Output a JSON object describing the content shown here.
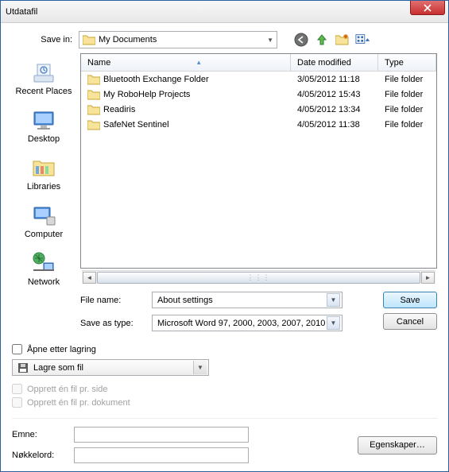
{
  "title": "Utdatafil",
  "savein": {
    "label": "Save in:",
    "value": "My Documents"
  },
  "columns": {
    "name": "Name",
    "date": "Date modified",
    "type": "Type"
  },
  "files": [
    {
      "name": "Bluetooth Exchange Folder",
      "date": "3/05/2012 11:18",
      "type": "File folder"
    },
    {
      "name": "My RoboHelp Projects",
      "date": "4/05/2012 15:43",
      "type": "File folder"
    },
    {
      "name": "Readiris",
      "date": "4/05/2012 13:34",
      "type": "File folder"
    },
    {
      "name": "SafeNet Sentinel",
      "date": "4/05/2012 11:38",
      "type": "File folder"
    }
  ],
  "places": {
    "recent": "Recent Places",
    "desktop": "Desktop",
    "libraries": "Libraries",
    "computer": "Computer",
    "network": "Network"
  },
  "form": {
    "filename_label": "File name:",
    "filename_value": "About settings",
    "savetype_label": "Save as type:",
    "savetype_value": "Microsoft Word 97, 2000, 2003, 2007, 2010"
  },
  "buttons": {
    "save": "Save",
    "cancel": "Cancel",
    "properties": "Egenskaper…"
  },
  "checks": {
    "open_after": "Åpne etter lagring",
    "lagre": "Lagre som fil",
    "per_side": "Opprett én fil pr. side",
    "per_dok": "Opprett én fil pr. dokument"
  },
  "bottom": {
    "emne": "Emne:",
    "nokkelord": "Nøkkelord:"
  }
}
